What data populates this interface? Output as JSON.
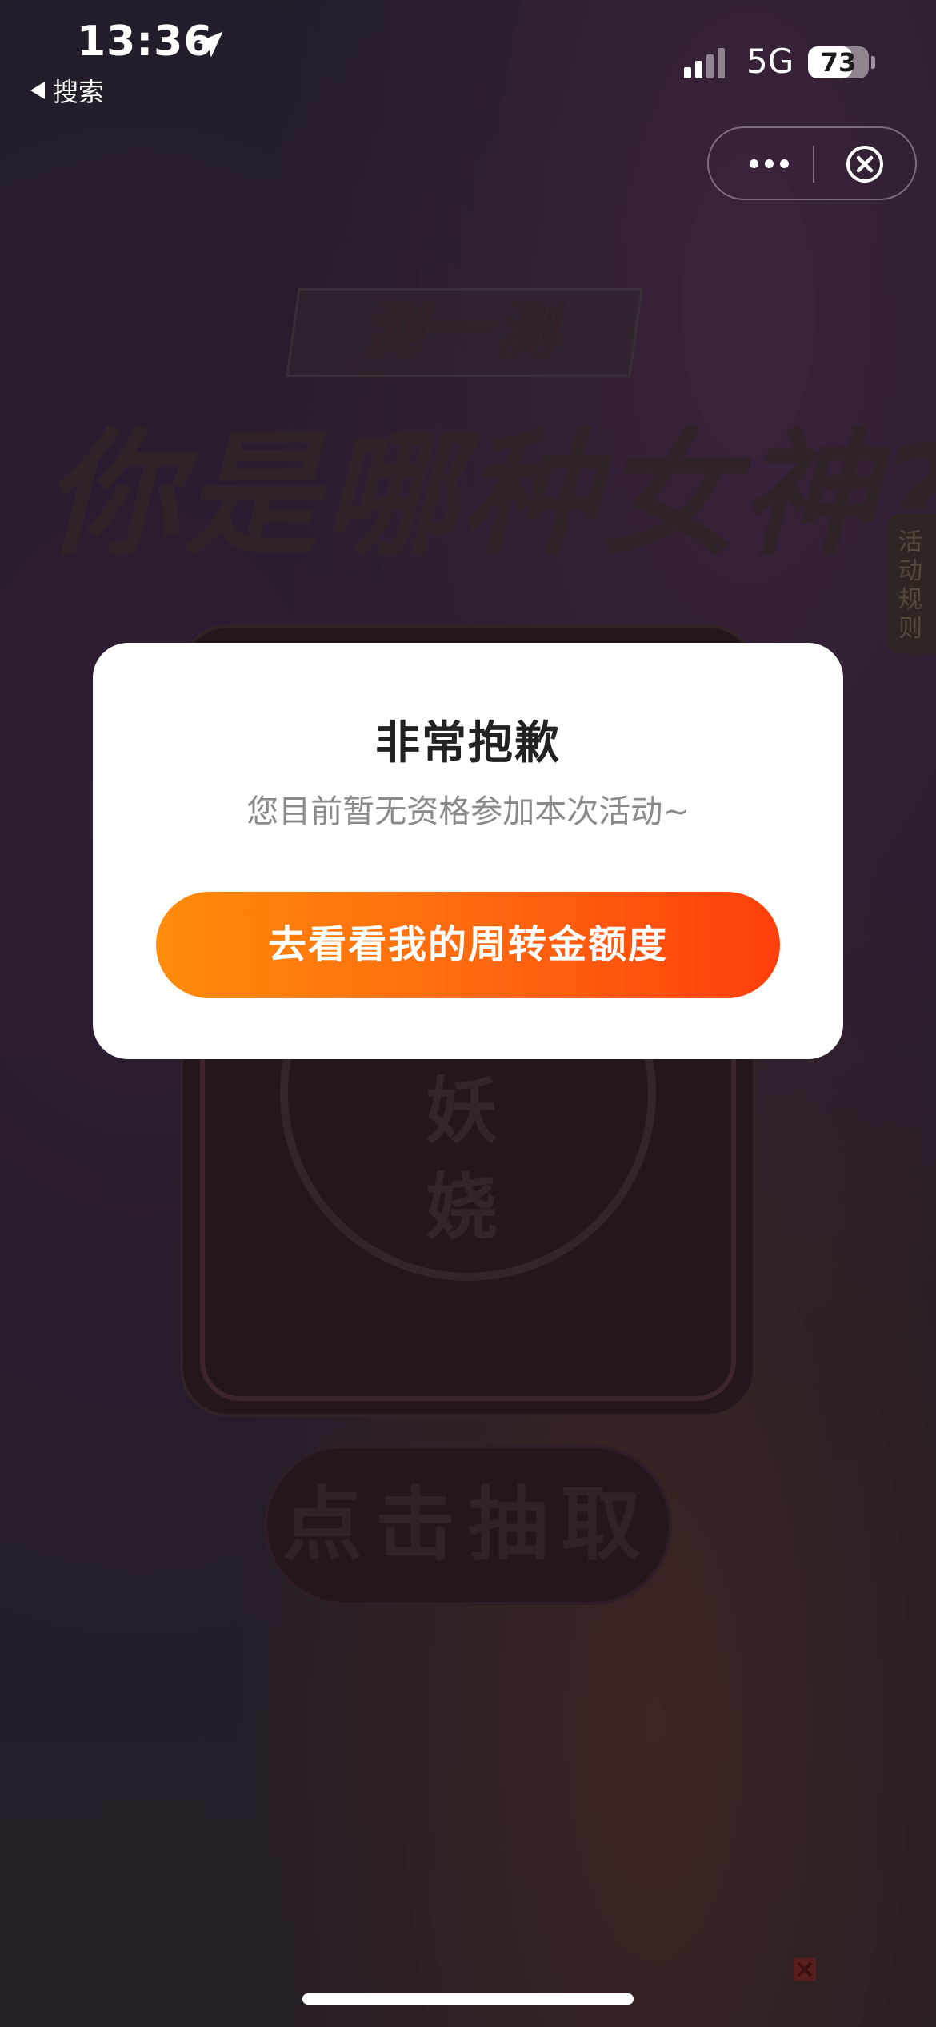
{
  "status_bar": {
    "time": "13:36",
    "back_label": "搜索",
    "network": "5G",
    "battery": "73",
    "battery_level": 0.73,
    "location_icon": "location-arrow-icon"
  },
  "mini_program": {
    "more_icon": "more-dots-icon",
    "close_icon": "close-circle-icon"
  },
  "background": {
    "tag": "测一测",
    "title": "你是哪种女神?",
    "rules_tab": "活动规则",
    "card_chars": [
      "妖",
      "娆"
    ],
    "draw_button": "点击抽取"
  },
  "modal": {
    "title": "非常抱歉",
    "message": "您目前暂无资格参加本次活动~",
    "button": "去看看我的周转金额度"
  },
  "colors": {
    "button_start": "#ff8c0a",
    "button_end": "#ff3f0c",
    "modal_bg": "#ffffff"
  }
}
